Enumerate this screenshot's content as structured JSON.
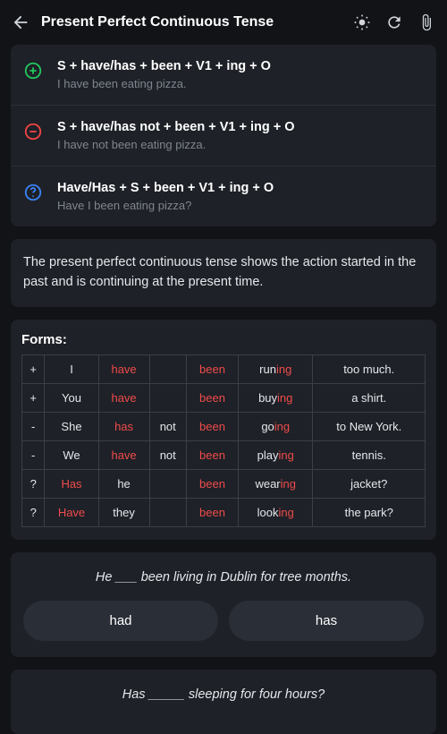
{
  "header": {
    "title": "Present Perfect Continuous Tense"
  },
  "formulas": [
    {
      "icon": "plus",
      "color": "#22c55e",
      "main": "S + have/has + been + V1 + ing + O",
      "sub": "I have been eating pizza."
    },
    {
      "icon": "minus",
      "color": "#ef4444",
      "main": "S + have/has not + been + V1 + ing + O",
      "sub": "I have not been eating pizza."
    },
    {
      "icon": "question",
      "color": "#3b82f6",
      "main": "Have/Has + S + been + V1 + ing + O",
      "sub": "Have I been eating pizza?"
    }
  ],
  "description": "The present perfect continuous tense shows the action started in the past and is continuing at the present time.",
  "forms": {
    "title": "Forms:",
    "rows": [
      {
        "sign": "+",
        "subj": "I",
        "aux": "have",
        "neg": "",
        "been": "been",
        "verb": "run",
        "suffix": "ing",
        "obj": "too much."
      },
      {
        "sign": "+",
        "subj": "You",
        "aux": "have",
        "neg": "",
        "been": "been",
        "verb": "buy",
        "suffix": "ing",
        "obj": "a shirt."
      },
      {
        "sign": "-",
        "subj": "She",
        "aux": "has",
        "neg": "not",
        "been": "been",
        "verb": "go",
        "suffix": "ing",
        "obj": "to New York."
      },
      {
        "sign": "-",
        "subj": "We",
        "aux": "have",
        "neg": "not",
        "been": "been",
        "verb": "play",
        "suffix": "ing",
        "obj": "tennis."
      },
      {
        "sign": "?",
        "subj": "he",
        "aux": "Has",
        "neg": "",
        "been": "been",
        "verb": "wear",
        "suffix": "ing",
        "obj": "jacket?",
        "auxFirst": true
      },
      {
        "sign": "?",
        "subj": "they",
        "aux": "Have",
        "neg": "",
        "been": "been",
        "verb": "look",
        "suffix": "ing",
        "obj": "the park?",
        "auxFirst": true
      }
    ]
  },
  "quiz1": {
    "question": "He ___ been living in Dublin for tree months.",
    "options": [
      "had",
      "has"
    ]
  },
  "quiz2": {
    "question": "Has _____ sleeping for four hours?"
  }
}
